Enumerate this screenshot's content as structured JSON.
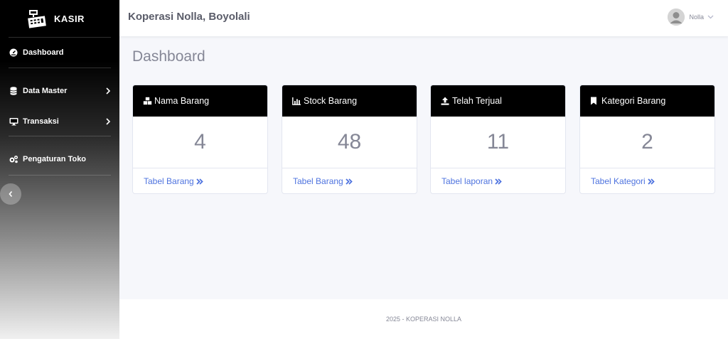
{
  "sidebar": {
    "brand": "KASIR",
    "items": [
      {
        "label": "Dashboard",
        "icon": "gauge-icon"
      },
      {
        "label": "Data Master",
        "icon": "database-icon"
      },
      {
        "label": "Transaksi",
        "icon": "desktop-icon"
      },
      {
        "label": "Pengaturan Toko",
        "icon": "cogs-icon"
      }
    ]
  },
  "topbar": {
    "store_name": "Koperasi Nolla, Boyolali",
    "user_name": "Nolla"
  },
  "page": {
    "title": "Dashboard"
  },
  "cards": [
    {
      "title": "Nama Barang",
      "value": "4",
      "link": "Tabel Barang",
      "icon": "cubes-icon"
    },
    {
      "title": "Stock Barang",
      "value": "48",
      "link": "Tabel Barang",
      "icon": "chart-bar-icon"
    },
    {
      "title": "Telah Terjual",
      "value": "11",
      "link": "Tabel laporan",
      "icon": "upload-icon"
    },
    {
      "title": "Kategori Barang",
      "value": "2",
      "link": "Tabel Kategori",
      "icon": "bookmark-icon"
    }
  ],
  "footer": {
    "text": "2025 - KOPERASI NOLLA"
  },
  "colors": {
    "accent": "#4e73df",
    "card_header": "#000000",
    "muted_text": "#858796"
  }
}
